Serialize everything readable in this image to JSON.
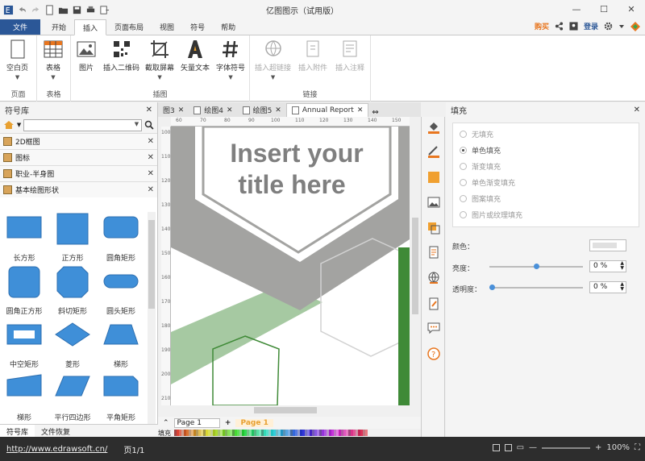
{
  "app": {
    "title": "亿图图示（试用版）"
  },
  "window_controls": {
    "minimize": "—",
    "maximize": "☐",
    "close": "✕"
  },
  "ribbon_tabs": [
    {
      "label": "文件"
    },
    {
      "label": "开始"
    },
    {
      "label": "插入"
    },
    {
      "label": "页面布局"
    },
    {
      "label": "视图"
    },
    {
      "label": "符号"
    },
    {
      "label": "帮助"
    }
  ],
  "ribbon_right": {
    "buy": "购买",
    "login": "登录"
  },
  "ribbon_groups": {
    "page": {
      "label": "页面",
      "buttons": [
        {
          "label": "空白页"
        }
      ]
    },
    "table": {
      "label": "表格",
      "buttons": [
        {
          "label": "表格"
        }
      ]
    },
    "illustration": {
      "label": "插图",
      "buttons": [
        {
          "label": "图片"
        },
        {
          "label": "插入二维码"
        },
        {
          "label": "截取屏幕"
        },
        {
          "label": "矢量文本"
        },
        {
          "label": "字体符号"
        }
      ]
    },
    "link": {
      "label": "链接",
      "buttons": [
        {
          "label": "插入超链接"
        },
        {
          "label": "插入附件"
        },
        {
          "label": "插入注释"
        }
      ]
    }
  },
  "left_panel": {
    "title": "符号库",
    "libraries": [
      {
        "label": "2D框图"
      },
      {
        "label": "图标"
      },
      {
        "label": "职业-半身图"
      },
      {
        "label": "基本绘图形状"
      }
    ],
    "shapes": [
      {
        "label": "长方形"
      },
      {
        "label": "正方形"
      },
      {
        "label": "圆角矩形"
      },
      {
        "label": "圆角正方形"
      },
      {
        "label": "斜切矩形"
      },
      {
        "label": "圆头矩形"
      },
      {
        "label": "中空矩形"
      },
      {
        "label": "菱形"
      },
      {
        "label": "梯形"
      },
      {
        "label": "梯形"
      },
      {
        "label": "平行四边形"
      },
      {
        "label": "平角矩形"
      }
    ],
    "bottom_tabs": [
      {
        "label": "符号库"
      },
      {
        "label": "文件恢复"
      }
    ]
  },
  "doc_tabs": [
    {
      "label": "图3"
    },
    {
      "label": "绘图4"
    },
    {
      "label": "绘图5"
    },
    {
      "label": "Annual Report"
    }
  ],
  "canvas": {
    "title_line1": "Insert your",
    "title_line2": "title here",
    "ruler_top": [
      "60",
      "70",
      "80",
      "90",
      "100",
      "110",
      "120",
      "130",
      "140",
      "150"
    ],
    "ruler_left": [
      "100",
      "110",
      "120",
      "130",
      "140",
      "150",
      "160",
      "170",
      "180",
      "190",
      "200",
      "210"
    ]
  },
  "page_bar": {
    "page_select": "Page 1",
    "add": "+",
    "current_page": "Page 1",
    "fill_label": "填充"
  },
  "fill_panel": {
    "title": "填充",
    "options": [
      {
        "label": "无填充",
        "selected": false
      },
      {
        "label": "单色填充",
        "selected": true
      },
      {
        "label": "渐变填充",
        "selected": false
      },
      {
        "label": "单色渐变填充",
        "selected": false
      },
      {
        "label": "图案填充",
        "selected": false
      },
      {
        "label": "图片或纹理填充",
        "selected": false
      }
    ],
    "color_label": "颜色：",
    "brightness_label": "亮度：",
    "brightness_value": "0 %",
    "transparency_label": "透明度：",
    "transparency_value": "0 %"
  },
  "status": {
    "url": "http://www.edrawsoft.cn/",
    "page": "页1/1",
    "zoom": "100%"
  },
  "colors": {
    "ribbon_file": "#2b5797",
    "shape_blue": "#3f8fd8",
    "canvas_gray": "#a3a3a1",
    "canvas_green": "#3f8a37",
    "canvas_lightgreen": "#a6c9a2",
    "accent_orange": "#e8761f"
  }
}
